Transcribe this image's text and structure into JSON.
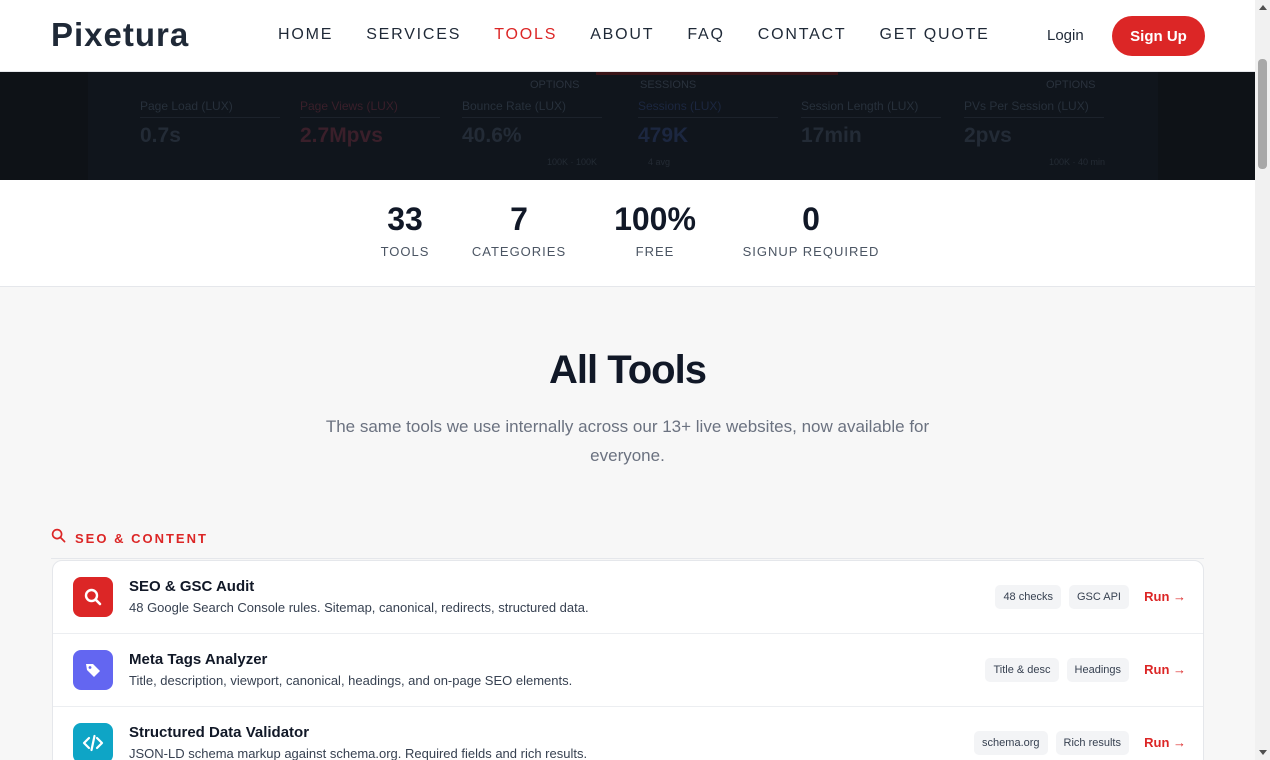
{
  "header": {
    "logo": "Pixetura",
    "nav": [
      "HOME",
      "SERVICES",
      "TOOLS",
      "ABOUT",
      "FAQ",
      "CONTACT",
      "GET QUOTE"
    ],
    "active_nav": "TOOLS",
    "login": "Login",
    "signup": "Sign Up"
  },
  "hero": {
    "options_left": "OPTIONS",
    "sessions_tab": "SESSIONS",
    "options_right": "OPTIONS",
    "metrics": [
      {
        "label": "Page Load (LUX)",
        "value": "0.7s"
      },
      {
        "label": "Page Views (LUX)",
        "value": "2.7Mpvs"
      },
      {
        "label": "Bounce Rate (LUX)",
        "value": "40.6%",
        "sub": "100K · 100K"
      },
      {
        "label": "Sessions (LUX)",
        "value": "479K",
        "sub": "4 avg"
      },
      {
        "label": "Session Length (LUX)",
        "value": "17min"
      },
      {
        "label": "PVs Per Session (LUX)",
        "value": "2pvs",
        "sub": "100K · 40 min"
      }
    ]
  },
  "stats": [
    {
      "num": "33",
      "label": "TOOLS"
    },
    {
      "num": "7",
      "label": "CATEGORIES"
    },
    {
      "num": "100%",
      "label": "FREE"
    },
    {
      "num": "0",
      "label": "SIGNUP REQUIRED"
    }
  ],
  "section": {
    "title": "All Tools",
    "subtitle": "The same tools we use internally across our 13+ live websites, now available for everyone."
  },
  "category": {
    "label": "SEO & CONTENT",
    "icon": "search-icon"
  },
  "tools": [
    {
      "name": "SEO & GSC Audit",
      "desc": "48 Google Search Console rules. Sitemap, canonical, redirects, structured data.",
      "tags": [
        "48 checks",
        "GSC API"
      ],
      "run": "Run →",
      "icon": "search-icon",
      "color": "#dc2626"
    },
    {
      "name": "Meta Tags Analyzer",
      "desc": "Title, description, viewport, canonical, headings, and on-page SEO elements.",
      "tags": [
        "Title & desc",
        "Headings"
      ],
      "run": "Run →",
      "icon": "tag-icon",
      "color": "#6366f1"
    },
    {
      "name": "Structured Data Validator",
      "desc": "JSON-LD schema markup against schema.org. Required fields and rich results.",
      "tags": [
        "schema.org",
        "Rich results"
      ],
      "run": "Run →",
      "icon": "code-icon",
      "color": "#0ea5c6"
    }
  ],
  "colors": {
    "accent": "#dc2626",
    "text": "#111827",
    "muted": "#6b7280"
  }
}
